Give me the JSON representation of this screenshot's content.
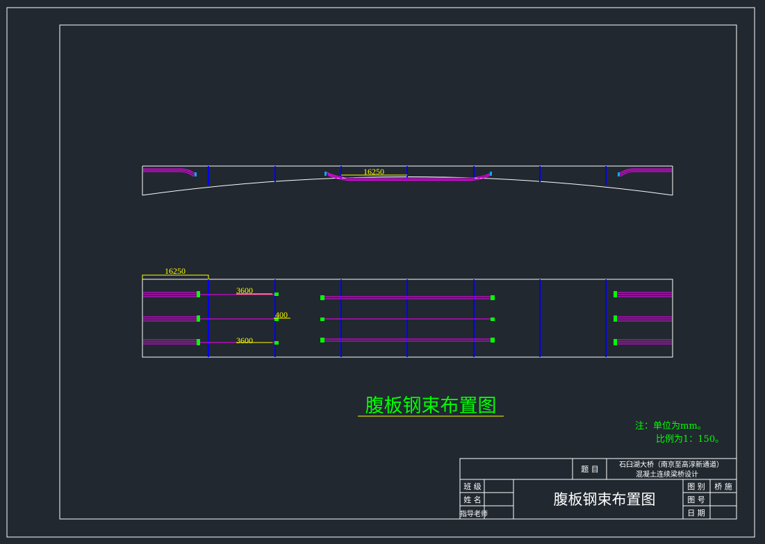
{
  "drawing": {
    "main_title": "腹板钢束布置图",
    "notes": {
      "line1": "注：单位为mm。",
      "line2": "比例为1：150。"
    },
    "elevation_view": {
      "dimension": "16250"
    },
    "plan_view": {
      "dim_top": "16250",
      "dim_upper": "3600",
      "dim_middle": "400",
      "dim_lower": "3600"
    }
  },
  "title_block": {
    "topic_label": "题 目",
    "project_line1": "石臼湖大桥（南京至高淳新通道）",
    "project_line2": "混凝土连续梁桥设计",
    "class_label": "班 级",
    "name_label": "姓 名",
    "advisor_label": "指导老师",
    "drawing_title": "腹板钢束布置图",
    "category_label": "图 别",
    "category_value": "桥 施",
    "number_label": "图 号",
    "date_label": "日 期"
  },
  "colors": {
    "background": "#212830",
    "frame": "#ffffff",
    "tendon": "#ff00ff",
    "section_line": "#0000ff",
    "anchor": "#00ff00",
    "dimension": "#ffff00",
    "title": "#00ff00"
  }
}
